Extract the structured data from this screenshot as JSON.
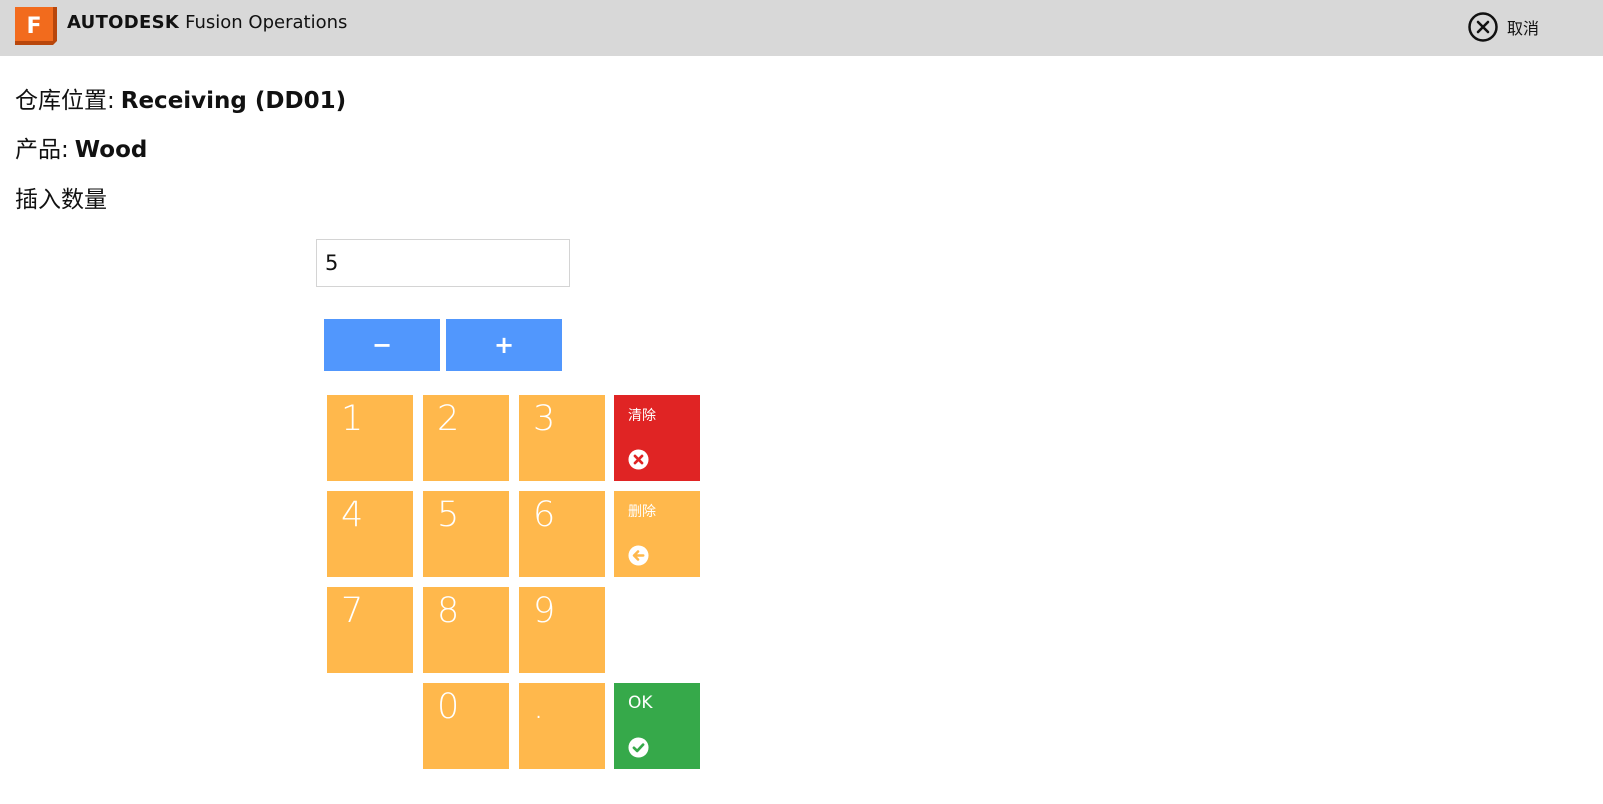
{
  "header": {
    "company": "AUTODESK",
    "product": "Fusion Operations",
    "logo_letter": "F",
    "logo_colors": {
      "main": "#f26b1d",
      "dark": "#b8460b"
    },
    "background": "#d8d8d8",
    "cancel": {
      "label": "取消",
      "icon": "circle-x-icon"
    }
  },
  "info": {
    "location_label": "仓库位置:",
    "location_value": "Receiving (DD01)",
    "product_label": "产品:",
    "product_value": "Wood",
    "prompt": "插入数量"
  },
  "quantity_input": {
    "value": "5"
  },
  "steppers": {
    "minus_label": "−",
    "plus_label": "+",
    "color": "#5197fd"
  },
  "keypad": {
    "key_color": "#ffb84c",
    "keys": {
      "k1": "1",
      "k2": "2",
      "k3": "3",
      "k4": "4",
      "k5": "5",
      "k6": "6",
      "k7": "7",
      "k8": "8",
      "k9": "9",
      "k0": "0",
      "kdot": "."
    },
    "clear": {
      "label": "清除",
      "icon": "x-circle-icon",
      "color": "#e02424"
    },
    "delete": {
      "label": "删除",
      "icon": "arrow-left-circle-icon",
      "color": "#ffb84c"
    },
    "ok": {
      "label": "OK",
      "icon": "check-circle-icon",
      "color": "#36a94a"
    }
  }
}
